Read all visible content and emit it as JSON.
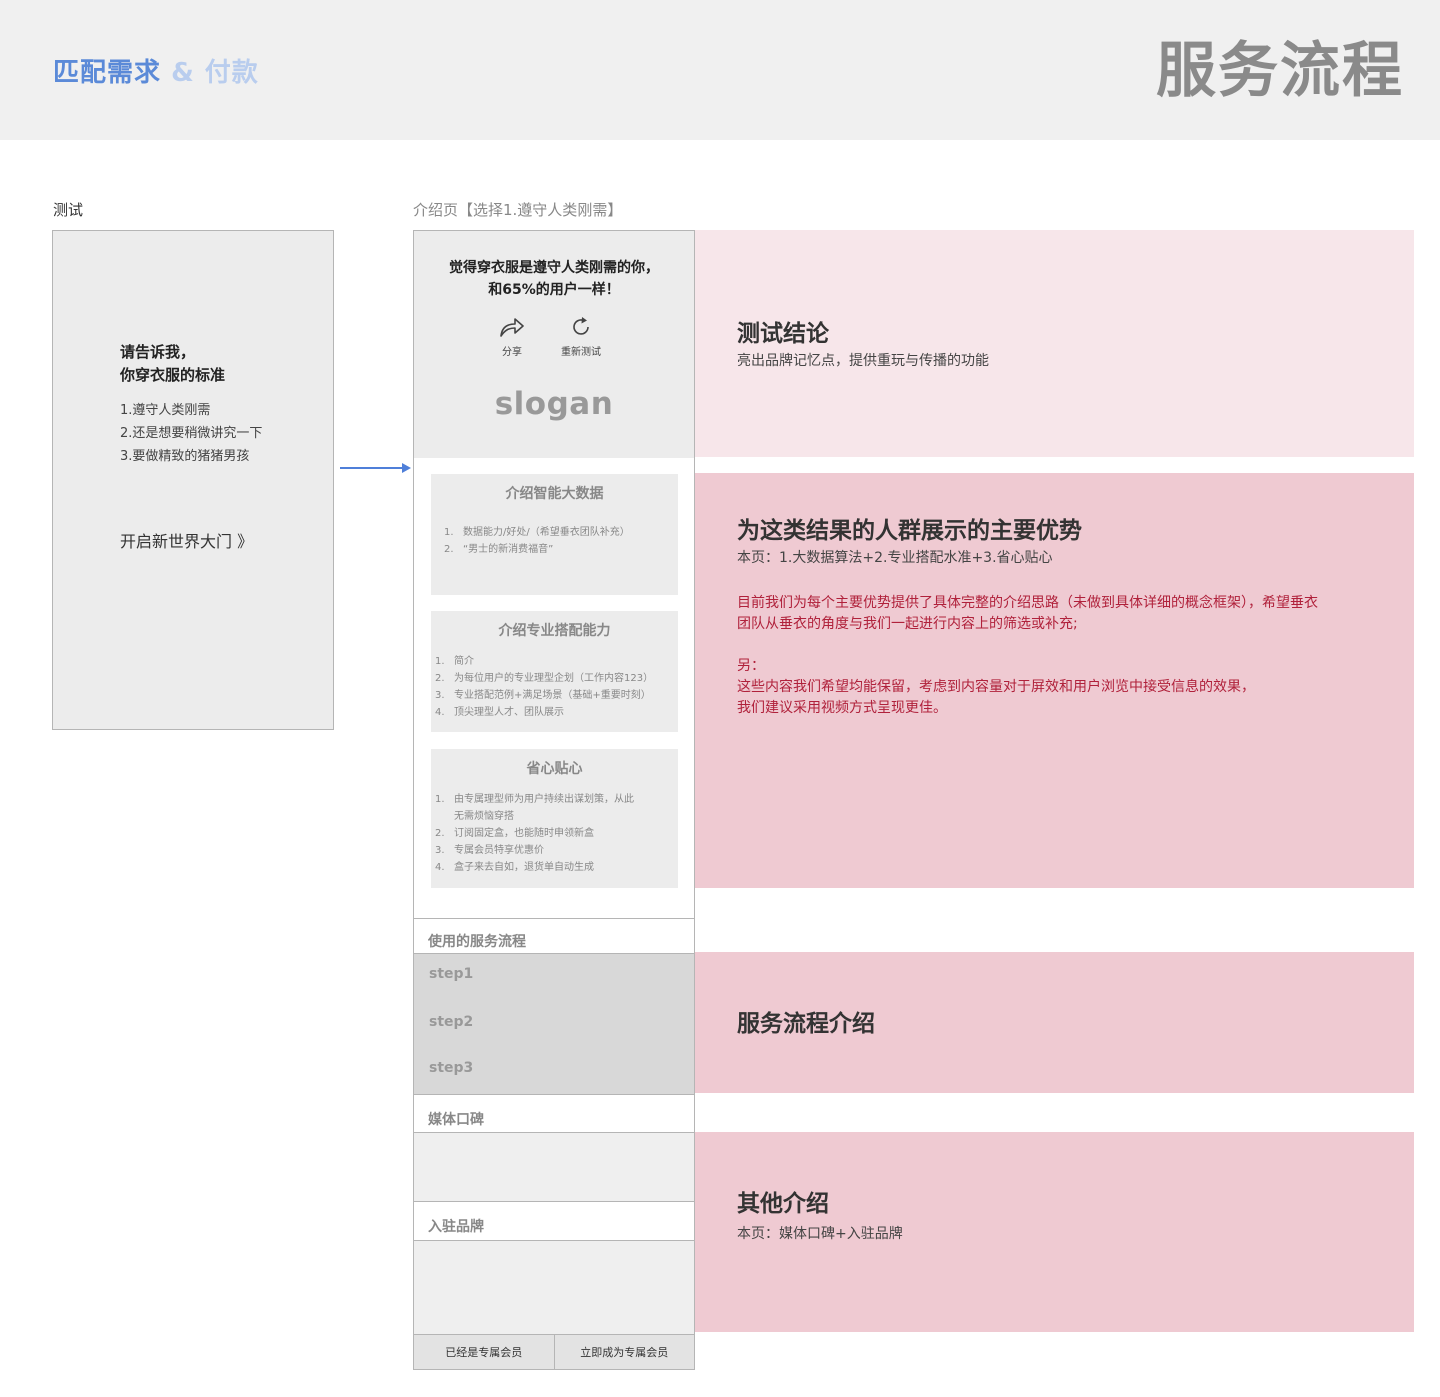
{
  "header": {
    "subtitle_part1": "匹配需求",
    "subtitle_part2": "& 付款",
    "title": "服务流程"
  },
  "labels": {
    "test": "测试",
    "intro": "介绍页【选择1.遵守人类刚需】"
  },
  "test_screen": {
    "question_line1": "请告诉我，",
    "question_line2": "你穿衣服的标准",
    "options": [
      "1.遵守人类刚需",
      "2.还是想要稍微讲究一下",
      "3.要做精致的猪猪男孩"
    ],
    "start_link": "开启新世界大门 》"
  },
  "intro_screen": {
    "result_line1": "觉得穿衣服是遵守人类刚需的你，",
    "result_line2": "和65%的用户一样！",
    "share_label": "分享",
    "retest_label": "重新测试",
    "slogan": "slogan",
    "card1": {
      "title": "介绍智能大数据",
      "items": [
        {
          "num": "1.",
          "text": "数据能力/好处/（希望垂衣团队补充）"
        },
        {
          "num": "2.",
          "text": "“男士的新消费福音”"
        }
      ]
    },
    "card2": {
      "title": "介绍专业搭配能力",
      "items": [
        {
          "num": "1.",
          "text": "简介"
        },
        {
          "num": "2.",
          "text": "为每位用户的专业理型企划（工作内容123）"
        },
        {
          "num": "3.",
          "text": "专业搭配范例+满足场景（基础+重要时刻）"
        },
        {
          "num": "4.",
          "text": "顶尖理型人才、团队展示"
        }
      ]
    },
    "card3": {
      "title": "省心贴心",
      "items": [
        {
          "num": "1.",
          "text": "由专属理型师为用户持续出谋划策，从此"
        },
        {
          "num": "",
          "text": "无需烦恼穿搭"
        },
        {
          "num": "2.",
          "text": "订阅固定盒，也能随时申领新盒"
        },
        {
          "num": "3.",
          "text": "专属会员特享优惠价"
        },
        {
          "num": "4.",
          "text": "盒子来去自如，退货单自动生成"
        }
      ]
    },
    "service_label": "使用的服务流程",
    "steps": [
      "step1",
      "step2",
      "step3"
    ],
    "media_label": "媒体口碑",
    "brand_label": "入驻品牌",
    "already_member": "已经是专属会员",
    "become_member": "立即成为专属会员"
  },
  "panels": {
    "conclusion": {
      "title": "测试结论",
      "desc": "亮出品牌记忆点，提供重玩与传播的功能"
    },
    "advantages": {
      "title": "为这类结果的人群展示的主要优势",
      "desc": "本页：1.大数据算法+2.专业搭配水准+3.省心贴心",
      "note_line1": "目前我们为每个主要优势提供了具体完整的介绍思路（未做到具体详细的概念框架），希望垂衣",
      "note_line2": "团队从垂衣的角度与我们一起进行内容上的筛选或补充;",
      "note_line3": "另：",
      "note_line4": "这些内容我们希望均能保留，考虑到内容量对于屏效和用户浏览中接受信息的效果，",
      "note_line5": "我们建议采用视频方式呈现更佳。"
    },
    "service": {
      "title": "服务流程介绍"
    },
    "other": {
      "title": "其他介绍",
      "desc": "本页：媒体口碑+入驻品牌"
    }
  },
  "colors": {
    "accent_blue": "#5b8ad8",
    "light_blue": "#b9cdee",
    "panel_light_pink": "#f7e6ea",
    "panel_pink": "#efcad2",
    "note_red": "#b0213b"
  }
}
